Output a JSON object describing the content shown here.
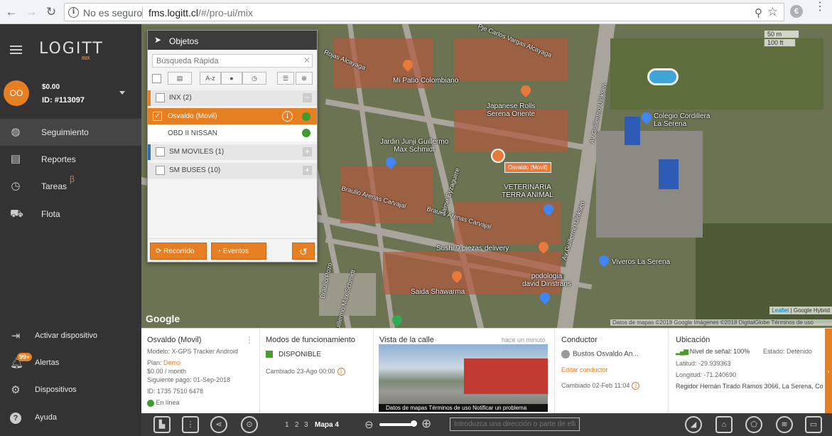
{
  "browser": {
    "security": "No es seguro",
    "url_host": "fms.logitt.cl",
    "url_path": "/#/pro-ui/mix"
  },
  "sidebar": {
    "logo": "LOGITT",
    "logo_sub": "INX",
    "avatar_initials": "OO",
    "balance": "$0.00",
    "user_id": "ID: #113097",
    "nav": [
      {
        "label": "Seguimiento",
        "icon": "globe-icon"
      },
      {
        "label": "Reportes",
        "icon": "chart-icon"
      },
      {
        "label": "Tareas",
        "icon": "clock-icon"
      },
      {
        "label": "Flota",
        "icon": "car-icon"
      }
    ],
    "beta": "β",
    "bottom": [
      {
        "label": "Activar dispositivo",
        "icon": "login-icon"
      },
      {
        "label": "Alertas",
        "icon": "bell-icon"
      },
      {
        "label": "Dispositivos",
        "icon": "gear-icon"
      },
      {
        "label": "Ayuda",
        "icon": "help-icon"
      }
    ],
    "alert_badge": "99+"
  },
  "map": {
    "labels": {
      "pcvargas": "Pje Carlos Vargas Alcayaga",
      "rojas": "Rojas Alcayaga",
      "patio": "Mi Patio Colombiano",
      "japanese": "Japanese Rolls\nSerena Oriente",
      "colegio": "Colegio Cordillera\nLa Serena",
      "jardin": "Jardin Junji Guillermo\nMax Schmidt",
      "veterinaria": "VETERINARIA\nTERRA ANIMAL",
      "braulio1": "Braulio Arenas Carvajal",
      "braulio2": "Braulio Arenas Carvajal",
      "jaime": "Jaime Eyzaguirre",
      "guillermo": "Av Guillermo Ulriksen",
      "guillermo2": "Av Guillermo Ulriksen",
      "sushi": "Sushi 9 piezas delivery",
      "viveros": "Viveros La Serena",
      "podologia": "podologia\ndavid Dinstrans",
      "saida": "Saida Shawarma",
      "pozo": "Braulio Pozo",
      "schmidt": "Guillermo Max Schmidt"
    },
    "vehicle_label": "Osvaldo (Movil)",
    "scale_m": "50 m",
    "scale_ft": "100 ft",
    "attribution_leaflet": "Leaflet",
    "attribution_google": "| Google Hybrid",
    "google_logo": "Google",
    "map_data": "Datos de mapas ©2018 Google Imágenes ©2018 DigitalGlobe   Términos de uso"
  },
  "panel": {
    "title": "Objetos",
    "search_placeholder": "Búsqueda Rápida",
    "toolbar": {
      "sort_az": "A-z"
    },
    "groups": [
      {
        "label": "INX (2)",
        "toggle": "−",
        "color": "#e67e22"
      },
      {
        "label": "SM MOVILES (1)",
        "toggle": "+",
        "color": "#2e6db5"
      },
      {
        "label": "SM BUSES (10)",
        "toggle": "+",
        "color": "#e6e6e6"
      }
    ],
    "selected_object": "Osvaldo (Movil)",
    "sub_object": "OBD II NISSAN",
    "buttons": {
      "recorrido": "Recorrido",
      "eventos": "Eventos"
    }
  },
  "info": {
    "device": {
      "name": "Osvaldo (Movil)",
      "model": "Modelo: X-GPS Tracker Android",
      "plan_label": "Plan: ",
      "plan_value": "Demo",
      "price": "$0.00 / month",
      "next_payment": "Siguiente pago: 01-Sep-2018",
      "id": "ID: 1735 7510 6478",
      "status": "En línea"
    },
    "modes": {
      "title": "Modos de funcionamiento",
      "value": "DISPONIBLE",
      "changed": "Cambiado 23-Ago 00:00"
    },
    "street": {
      "title": "Vista de la calle",
      "time": "hace un minuto",
      "footer": "Datos de mapas   Términos de uso   Notificar un problema"
    },
    "driver": {
      "title": "Conductor",
      "name": "Bustos Osvaldo An...",
      "edit": "Editar conductor",
      "changed": "Cambiado 02-Feb 11:04"
    },
    "location": {
      "title": "Ubicación",
      "signal": "Nivel de señal: 100%",
      "status": "Estado: Detenido",
      "lat": "Latitud: -29.939363",
      "lon": "Longitud: -71.240690",
      "address": "Regidor Hernán Tirado Ramos 3066, La Serena, Coquimbo"
    }
  },
  "bottombar": {
    "pages": [
      "1",
      "2",
      "3"
    ],
    "map_label": "Mapa 4",
    "address_placeholder": "Introduzca una dirección o parte de ella"
  },
  "colors": {
    "accent": "#e67e22",
    "sidebar": "#333333",
    "online": "#3c9c2c"
  }
}
